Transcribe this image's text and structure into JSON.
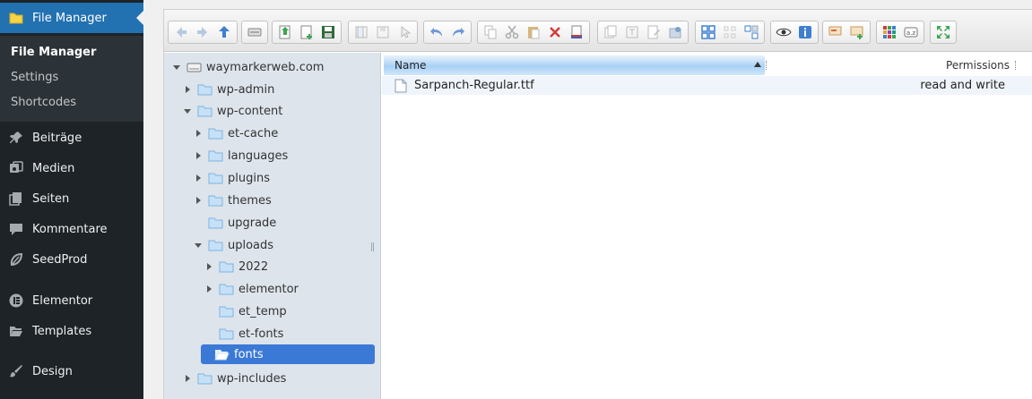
{
  "sidebar": {
    "top_item": {
      "label": "File Manager",
      "icon": "folder-icon"
    },
    "submenu": [
      "File Manager",
      "Settings",
      "Shortcodes"
    ],
    "items": [
      {
        "label": "Beiträge",
        "icon": "pin-icon"
      },
      {
        "label": "Medien",
        "icon": "media-icon"
      },
      {
        "label": "Seiten",
        "icon": "pages-icon"
      },
      {
        "label": "Kommentare",
        "icon": "comment-icon"
      },
      {
        "label": "SeedProd",
        "icon": "seedprod-icon"
      },
      {
        "label": "Elementor",
        "icon": "elementor-icon"
      },
      {
        "label": "Templates",
        "icon": "folder-open-icon"
      },
      {
        "label": "Design",
        "icon": "brush-icon"
      }
    ]
  },
  "tree": {
    "root": "waymarkerweb.com",
    "nodes": [
      {
        "label": "wp-admin"
      },
      {
        "label": "wp-content"
      },
      {
        "label": "et-cache"
      },
      {
        "label": "languages"
      },
      {
        "label": "plugins"
      },
      {
        "label": "themes"
      },
      {
        "label": "upgrade"
      },
      {
        "label": "uploads"
      },
      {
        "label": "2022"
      },
      {
        "label": "elementor"
      },
      {
        "label": "et_temp"
      },
      {
        "label": "et-fonts"
      },
      {
        "label": "fonts"
      },
      {
        "label": "wp-includes"
      }
    ]
  },
  "list": {
    "columns": {
      "name": "Name",
      "permissions": "Permissions"
    },
    "rows": [
      {
        "name": "Sarpanch-Regular.ttf",
        "permissions": "read and write"
      }
    ]
  },
  "colors": {
    "sidebar_bg": "#1d2327",
    "active_item": "#2271b1",
    "tree_bg": "#dde4ec",
    "tree_selected": "#3b79d6"
  }
}
